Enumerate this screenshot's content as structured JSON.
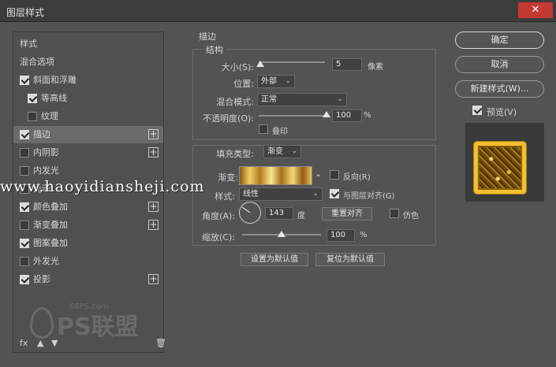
{
  "window": {
    "title": "图层样式"
  },
  "left_panel": {
    "items": [
      {
        "label": "样式",
        "checkbox": null,
        "plus": false,
        "selected": false,
        "indent": 0
      },
      {
        "label": "混合选项",
        "checkbox": null,
        "plus": false,
        "selected": false,
        "indent": 0
      },
      {
        "label": "斜面和浮雕",
        "checkbox": true,
        "plus": false,
        "selected": false,
        "indent": 0
      },
      {
        "label": "等高线",
        "checkbox": true,
        "plus": false,
        "selected": false,
        "indent": 1
      },
      {
        "label": "纹理",
        "checkbox": false,
        "plus": false,
        "selected": false,
        "indent": 1
      },
      {
        "label": "描边",
        "checkbox": true,
        "plus": true,
        "selected": true,
        "indent": 0
      },
      {
        "label": "内阴影",
        "checkbox": false,
        "plus": true,
        "selected": false,
        "indent": 0
      },
      {
        "label": "内发光",
        "checkbox": false,
        "plus": false,
        "selected": false,
        "indent": 0
      },
      {
        "label": "光泽",
        "checkbox": false,
        "plus": false,
        "selected": false,
        "indent": 0
      },
      {
        "label": "颜色叠加",
        "checkbox": true,
        "plus": true,
        "selected": false,
        "indent": 0
      },
      {
        "label": "渐变叠加",
        "checkbox": false,
        "plus": true,
        "selected": false,
        "indent": 0
      },
      {
        "label": "图案叠加",
        "checkbox": true,
        "plus": false,
        "selected": false,
        "indent": 0
      },
      {
        "label": "外发光",
        "checkbox": false,
        "plus": false,
        "selected": false,
        "indent": 0
      },
      {
        "label": "投影",
        "checkbox": true,
        "plus": true,
        "selected": false,
        "indent": 0
      }
    ],
    "bottom": {
      "fx": "fx",
      "trash": "🗑"
    }
  },
  "stroke": {
    "section_title": "描边",
    "structure_title": "结构",
    "size_label": "大小(S):",
    "size_value": "5",
    "size_unit": "像素",
    "size_level": 0.02,
    "position_label": "位置:",
    "position_value": "外部",
    "blend_label": "混合模式:",
    "blend_value": "正常",
    "opacity_label": "不透明度(O):",
    "opacity_value": "100",
    "opacity_unit": "%",
    "opacity_level": 1.0,
    "overprint_label": "叠印",
    "fill_type_label": "填充类型:",
    "fill_type_value": "渐变",
    "gradient_label": "渐变:",
    "reverse_label": "反向(R)",
    "style_label": "样式:",
    "style_value": "线性",
    "align_label": "与图层对齐(G)",
    "angle_label": "角度(A):",
    "angle_value": "143",
    "angle_unit": "度",
    "reset_align_label": "重置对齐",
    "dither_label": "仿色",
    "scale_label": "缩放(C):",
    "scale_value": "100",
    "scale_unit": "%",
    "scale_level": 0.5,
    "set_default_label": "设置为默认值",
    "reset_default_label": "复位为默认值"
  },
  "right_panel": {
    "ok_label": "确定",
    "cancel_label": "取消",
    "new_style_label": "新建样式(W)...",
    "preview_label": "预览(V)"
  },
  "watermark": {
    "text": "www.haoyidiansheji.com"
  },
  "logo": {
    "site_text": "68PS.com",
    "brand_text": "PS联盟"
  }
}
